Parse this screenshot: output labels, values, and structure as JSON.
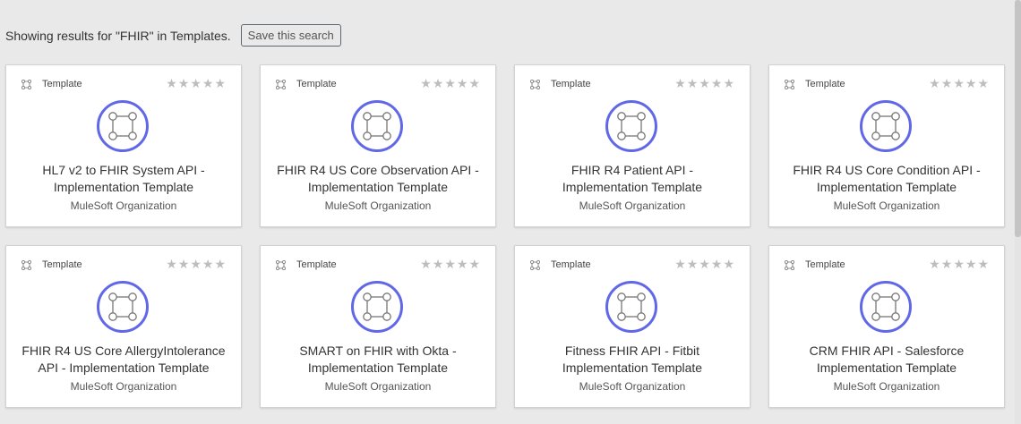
{
  "header": {
    "results_text": "Showing results for \"FHIR\" in Templates.",
    "save_label": "Save this search"
  },
  "colors": {
    "accent": "#6168e8",
    "star_empty": "#bdbdbd"
  },
  "rating_stars": 5,
  "cards": [
    {
      "type": "Template",
      "title_line1": "HL7 v2 to FHIR System API -",
      "title_line2": "Implementation Template",
      "org": "MuleSoft Organization",
      "rating": 0
    },
    {
      "type": "Template",
      "title_line1": "FHIR R4 US Core Observation API -",
      "title_line2": "Implementation Template",
      "org": "MuleSoft Organization",
      "rating": 0
    },
    {
      "type": "Template",
      "title_line1": "FHIR R4 Patient API -",
      "title_line2": "Implementation Template",
      "org": "MuleSoft Organization",
      "rating": 0
    },
    {
      "type": "Template",
      "title_line1": "FHIR R4 US Core Condition API -",
      "title_line2": "Implementation Template",
      "org": "MuleSoft Organization",
      "rating": 0
    },
    {
      "type": "Template",
      "title_line1": "FHIR R4 US Core AllergyIntolerance",
      "title_line2": "API - Implementation Template",
      "org": "MuleSoft Organization",
      "rating": 0
    },
    {
      "type": "Template",
      "title_line1": "SMART on FHIR with Okta -",
      "title_line2": "Implementation Template",
      "org": "MuleSoft Organization",
      "rating": 0
    },
    {
      "type": "Template",
      "title_line1": "Fitness FHIR API - Fitbit",
      "title_line2": "Implementation Template",
      "org": "MuleSoft Organization",
      "rating": 0
    },
    {
      "type": "Template",
      "title_line1": "CRM FHIR API - Salesforce",
      "title_line2": "Implementation Template",
      "org": "MuleSoft Organization",
      "rating": 0
    }
  ]
}
